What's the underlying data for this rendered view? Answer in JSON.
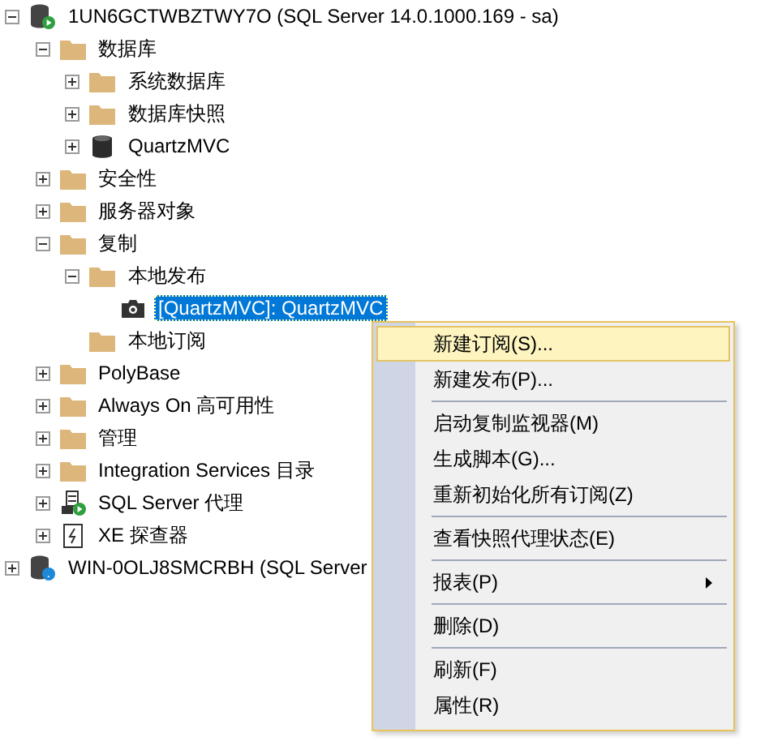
{
  "tree": [
    {
      "label": "1UN6GCTWBZTWY7O (SQL Server 14.0.1000.169 - sa)",
      "kind": "server",
      "expanded": true,
      "selected": false,
      "children": [
        {
          "label": "数据库",
          "kind": "folder",
          "expanded": true,
          "selected": false,
          "children": [
            {
              "label": "系统数据库",
              "kind": "folder",
              "expanded": false,
              "selected": false
            },
            {
              "label": "数据库快照",
              "kind": "folder",
              "expanded": false,
              "selected": false
            },
            {
              "label": "QuartzMVC",
              "kind": "database",
              "expanded": false,
              "selected": false
            }
          ]
        },
        {
          "label": "安全性",
          "kind": "folder",
          "expanded": false,
          "selected": false
        },
        {
          "label": "服务器对象",
          "kind": "folder",
          "expanded": false,
          "selected": false
        },
        {
          "label": "复制",
          "kind": "folder",
          "expanded": true,
          "selected": false,
          "children": [
            {
              "label": "本地发布",
              "kind": "folder",
              "expanded": true,
              "selected": false,
              "children": [
                {
                  "label": "[QuartzMVC]: QuartzMVC",
                  "kind": "publication",
                  "selected": true
                }
              ]
            },
            {
              "label": "本地订阅",
              "kind": "folder",
              "selected": false
            }
          ]
        },
        {
          "label": "PolyBase",
          "kind": "folder",
          "expanded": false,
          "selected": false
        },
        {
          "label": "Always On 高可用性",
          "kind": "folder",
          "expanded": false,
          "selected": false
        },
        {
          "label": "管理",
          "kind": "folder",
          "expanded": false,
          "selected": false
        },
        {
          "label": "Integration Services 目录",
          "kind": "folder",
          "expanded": false,
          "selected": false
        },
        {
          "label": "SQL Server 代理",
          "kind": "agent",
          "expanded": false,
          "selected": false
        },
        {
          "label": "XE 探查器",
          "kind": "profiler",
          "expanded": false,
          "selected": false
        }
      ]
    },
    {
      "label": "WIN-0OLJ8SMCRBH (SQL Server",
      "kind": "server_unknown",
      "expanded": false,
      "selected": false
    }
  ],
  "context_menu": [
    {
      "kind": "item",
      "label": "新建订阅(S)...",
      "selected": true
    },
    {
      "kind": "item",
      "label": "新建发布(P)...",
      "selected": false
    },
    {
      "kind": "separator"
    },
    {
      "kind": "item",
      "label": "启动复制监视器(M)",
      "selected": false
    },
    {
      "kind": "item",
      "label": "生成脚本(G)...",
      "selected": false
    },
    {
      "kind": "item",
      "label": "重新初始化所有订阅(Z)",
      "selected": false
    },
    {
      "kind": "separator"
    },
    {
      "kind": "item",
      "label": "查看快照代理状态(E)",
      "selected": false
    },
    {
      "kind": "separator"
    },
    {
      "kind": "item",
      "label": "报表(P)",
      "selected": false,
      "submenu": true
    },
    {
      "kind": "separator"
    },
    {
      "kind": "item",
      "label": "删除(D)",
      "selected": false
    },
    {
      "kind": "separator"
    },
    {
      "kind": "item",
      "label": "刷新(F)",
      "selected": false
    },
    {
      "kind": "item",
      "label": "属性(R)",
      "selected": false
    }
  ]
}
